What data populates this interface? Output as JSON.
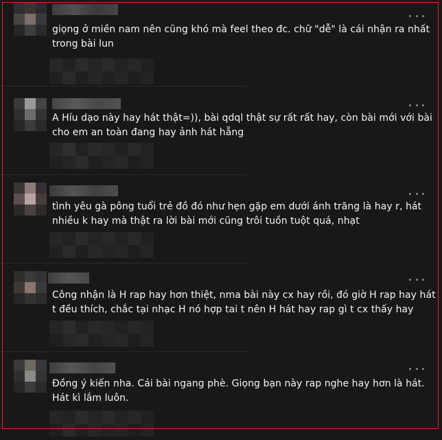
{
  "comments": [
    {
      "text": "giọng ở miền nam nên cũng khó mà feel theo đc. chữ \"dễ\" là cái nhận ra nhất trong bài lun"
    },
    {
      "text": "A Híu dạo này hay hát thật=)), bài qdql thật sự rất rất hay, còn bài mới với bài cho em an toàn đang hay ảnh hát hẵng"
    },
    {
      "text": "tình yêu gà pông tuổi trẻ đồ đó như hẹn gặp em dưới ánh trăng là hay r, hát nhiều k hay mà thật ra lời bài mới cũng trôi tuồn tuột quá, nhạt"
    },
    {
      "text": "Công nhận là H rap hay hơn thiệt, nma bài này cx hay rồi, đó giờ H rap hay hát t đều thích, chắc tại nhạc H nó hợp tai t nên H hát hay rap gì t cx thấy hay"
    },
    {
      "text": "Đồng ý kiến nha. Cái bài ngang phè. Giọng bạn này rap nghe hay hơn là hát. Hát kì lắm luôn."
    }
  ],
  "colors": {
    "background": "#181818",
    "text": "#f3f5f7",
    "highlight_border": "#e3262c",
    "divider": "#2a2a2a",
    "menu_dots": "#8a8a8a"
  },
  "icons": {
    "more": "more-options-icon"
  }
}
